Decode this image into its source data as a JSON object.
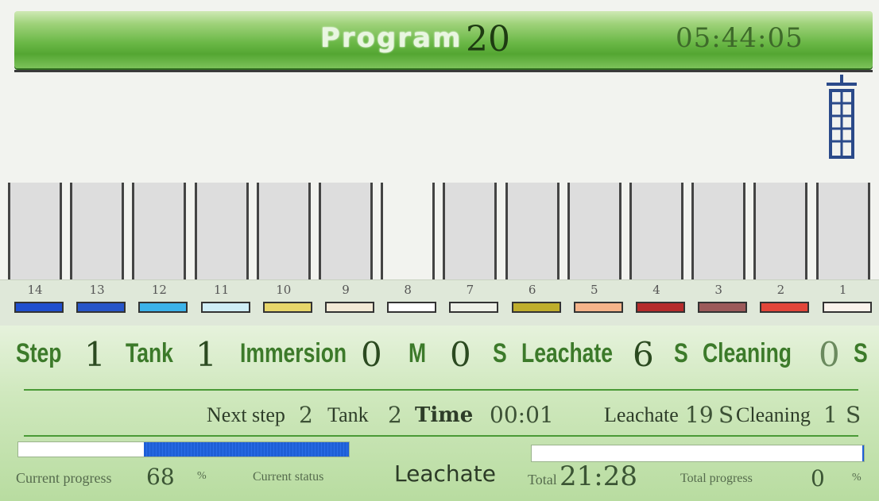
{
  "header": {
    "title_word": "Program",
    "program_number": "20",
    "clock": "05:44:05"
  },
  "tanks": [
    {
      "num": "14",
      "color": "#1f4fcf",
      "empty": false
    },
    {
      "num": "13",
      "color": "#2756c9",
      "empty": false
    },
    {
      "num": "12",
      "color": "#3cb3ea",
      "empty": false
    },
    {
      "num": "11",
      "color": "#cfeef6",
      "empty": false
    },
    {
      "num": "10",
      "color": "#e7d66a",
      "empty": false
    },
    {
      "num": "9",
      "color": "#f3ead6",
      "empty": false
    },
    {
      "num": "8",
      "color": "#ffffff",
      "empty": true
    },
    {
      "num": "7",
      "color": "#eef1e8",
      "empty": false
    },
    {
      "num": "6",
      "color": "#bfae2c",
      "empty": false
    },
    {
      "num": "5",
      "color": "#f5b48a",
      "empty": false
    },
    {
      "num": "4",
      "color": "#b62b2b",
      "empty": false
    },
    {
      "num": "3",
      "color": "#9c5a5a",
      "empty": false
    },
    {
      "num": "2",
      "color": "#e2463a",
      "empty": false
    },
    {
      "num": "1",
      "color": "#fbf3ec",
      "empty": false
    }
  ],
  "status_row": {
    "step_label": "Step",
    "step_value": "1",
    "tank_label": "Tank",
    "tank_value": "1",
    "immersion_label": "Immersion",
    "immersion_value": "0",
    "minutes_unit": "M",
    "seconds_value": "0",
    "seconds_unit": "S",
    "leachate_label": "Leachate",
    "leachate_value": "6",
    "leachate_unit": "S",
    "cleaning_label": "Cleaning",
    "cleaning_value": "0",
    "cleaning_unit": "S"
  },
  "next_row": {
    "next_step_label": "Next step",
    "next_step_value": "2",
    "tank_label": "Tank",
    "tank_value": "2",
    "time_label": "Time",
    "time_value": "00:01",
    "leachate_label": "Leachate",
    "leachate_value": "19",
    "leachate_unit": "S",
    "cleaning_label": "Cleaning",
    "cleaning_value": "1",
    "cleaning_unit": "S"
  },
  "progress": {
    "current_label": "Current progress",
    "current_value": "68",
    "current_unit": "%",
    "current_fraction": 0.68,
    "status_label": "Current status",
    "status_value": "Leachate",
    "total_label": "Total",
    "total_time": "21:28",
    "total_progress_label": "Total progress",
    "total_value": "0",
    "total_unit": "%",
    "total_fraction": 0.0
  }
}
